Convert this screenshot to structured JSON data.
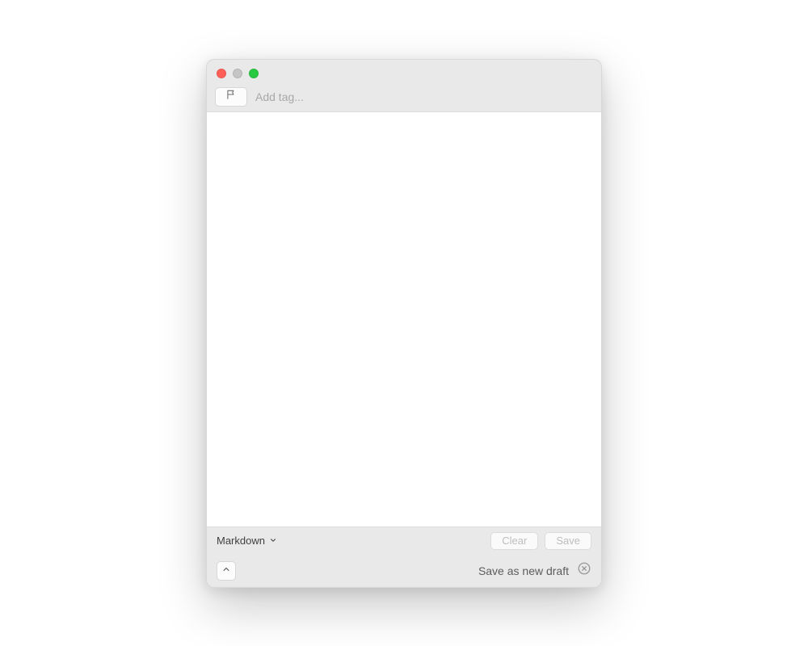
{
  "toolbar": {
    "tag_input_placeholder": "Add tag..."
  },
  "footer": {
    "format_label": "Markdown",
    "clear_label": "Clear",
    "save_label": "Save",
    "draft_label": "Save as new draft"
  }
}
